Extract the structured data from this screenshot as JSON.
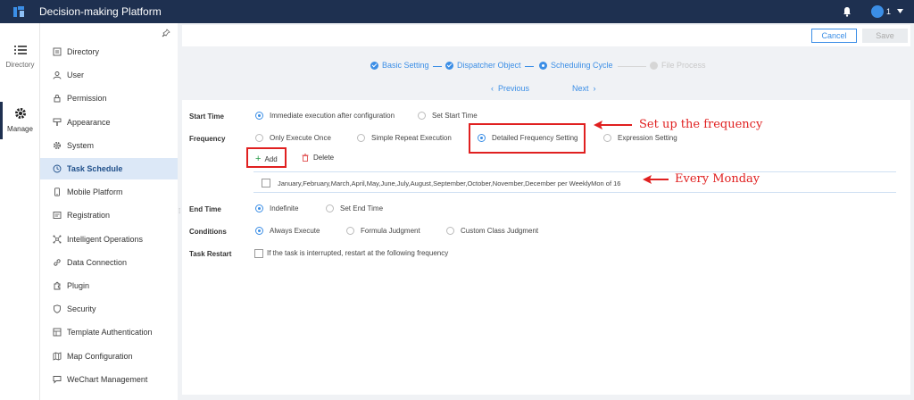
{
  "app": {
    "title": "Decision-making Platform",
    "user_label": "1"
  },
  "leftnav": {
    "directory_label": "Directory",
    "manage_label": "Manage"
  },
  "sidebar": {
    "items": [
      {
        "label": "Directory",
        "icon": "list-icon"
      },
      {
        "label": "User",
        "icon": "user-icon"
      },
      {
        "label": "Permission",
        "icon": "lock-icon"
      },
      {
        "label": "Appearance",
        "icon": "brush-icon"
      },
      {
        "label": "System",
        "icon": "gear-icon"
      },
      {
        "label": "Task Schedule",
        "icon": "clock-icon"
      },
      {
        "label": "Mobile Platform",
        "icon": "phone-icon"
      },
      {
        "label": "Registration",
        "icon": "registration-icon"
      },
      {
        "label": "Intelligent Operations",
        "icon": "network-icon"
      },
      {
        "label": "Data Connection",
        "icon": "link-icon"
      },
      {
        "label": "Plugin",
        "icon": "plugin-icon"
      },
      {
        "label": "Security",
        "icon": "shield-icon"
      },
      {
        "label": "Template Authentication",
        "icon": "template-icon"
      },
      {
        "label": "Map Configuration",
        "icon": "map-icon"
      },
      {
        "label": "WeChart Management",
        "icon": "chat-icon"
      }
    ],
    "active_index": 5
  },
  "toolbar": {
    "cancel_label": "Cancel",
    "save_label": "Save"
  },
  "steps": {
    "items": [
      {
        "label": "Basic Setting",
        "state": "done"
      },
      {
        "label": "Dispatcher Object",
        "state": "done"
      },
      {
        "label": "Scheduling Cycle",
        "state": "current"
      },
      {
        "label": "File Process",
        "state": "pending"
      }
    ],
    "previous_label": "Previous",
    "next_label": "Next"
  },
  "form": {
    "start_time": {
      "label": "Start Time",
      "options": [
        "Immediate execution after configuration",
        "Set Start Time"
      ],
      "selected": 0
    },
    "frequency": {
      "label": "Frequency",
      "options": [
        "Only Execute Once",
        "Simple Repeat Execution",
        "Detailed Frequency Setting",
        "Expression Setting"
      ],
      "selected": 2
    },
    "add_label": "Add",
    "delete_label": "Delete",
    "frequency_entry": "January,February,March,April,May,June,July,August,September,October,November,December per WeeklyMon of 16",
    "end_time": {
      "label": "End Time",
      "options": [
        "Indefinite",
        "Set End Time"
      ],
      "selected": 0
    },
    "conditions": {
      "label": "Conditions",
      "options": [
        "Always Execute",
        "Formula Judgment",
        "Custom Class Judgment"
      ],
      "selected": 0
    },
    "task_restart": {
      "label": "Task Restart",
      "checkbox_label": "If the task is interrupted, restart at the following frequency"
    }
  },
  "annotations": {
    "frequency_note": "Set up the frequency",
    "monday_note": "Every Monday"
  },
  "colors": {
    "topbar": "#1e3050",
    "accent": "#3b8ee6",
    "annotation": "#e02020",
    "active_menu_bg": "#dce8f7"
  }
}
